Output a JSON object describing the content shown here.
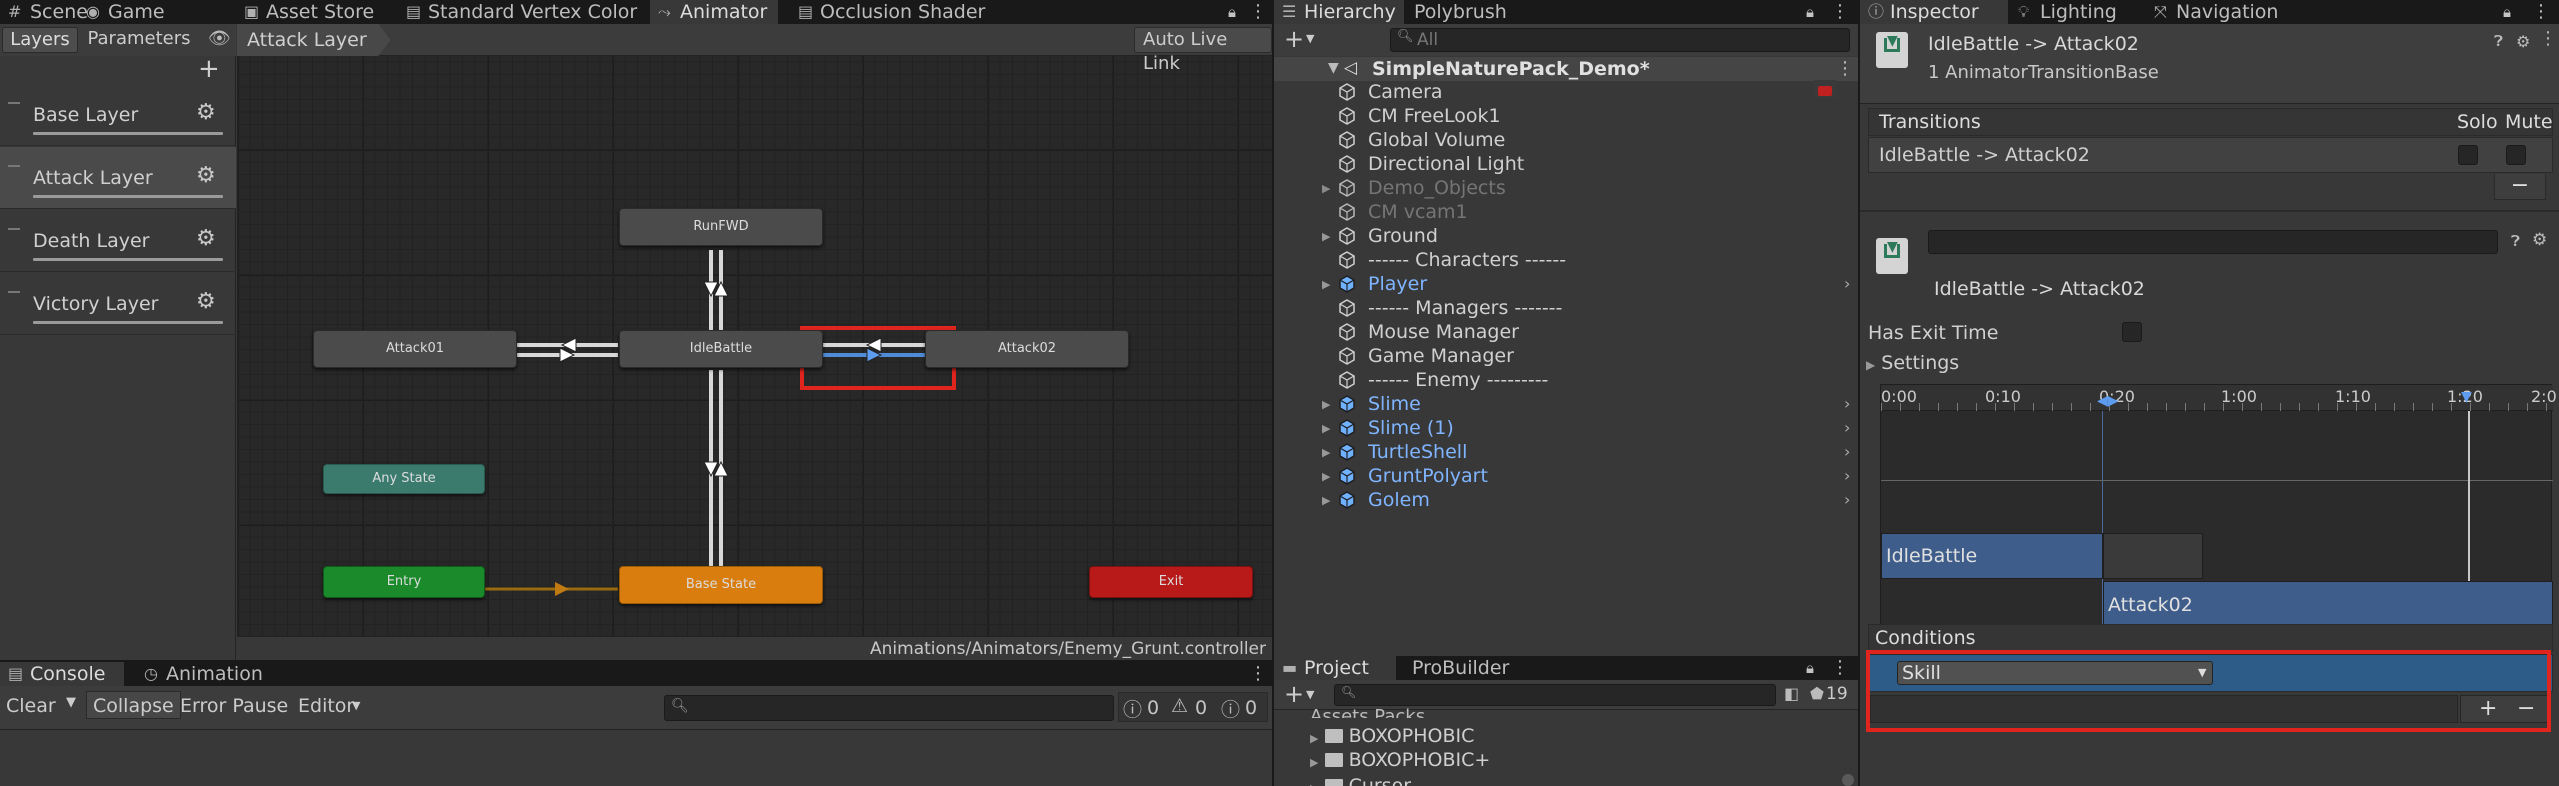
{
  "top_tabs": [
    {
      "label": "Scene",
      "icon": "hash-icon"
    },
    {
      "label": "Game",
      "icon": "game-icon"
    },
    {
      "label": "Asset Store",
      "icon": "bag-icon"
    },
    {
      "label": "Standard Vertex Color",
      "icon": "doc-icon"
    },
    {
      "label": "Animator",
      "icon": "animator-icon"
    },
    {
      "label": "Occlusion Shader",
      "icon": "doc-icon"
    }
  ],
  "animator": {
    "sub_tabs": [
      "Layers",
      "Parameters"
    ],
    "breadcrumb": "Attack Layer",
    "auto_live_link": "Auto Live Link",
    "layers": [
      "Base Layer",
      "Attack Layer",
      "Death Layer",
      "Victory Layer"
    ],
    "nodes": {
      "run": "RunFWD",
      "attack01": "Attack01",
      "idle": "IdleBattle",
      "attack02": "Attack02",
      "any": "Any State",
      "entry": "Entry",
      "base": "Base State",
      "exit": "Exit"
    },
    "path": "Animations/Animators/Enemy_Grunt.controller"
  },
  "console": {
    "tabs": [
      "Console",
      "Animation"
    ],
    "buttons": [
      "Clear",
      "Collapse",
      "Error Pause",
      "Editor"
    ],
    "counts": {
      "info": "0",
      "warn": "0",
      "error": "0"
    }
  },
  "hierarchy": {
    "tabs": [
      "Hierarchy",
      "Polybrush"
    ],
    "search_placeholder": "All",
    "scene": "SimpleNaturePack_Demo*",
    "items": [
      {
        "label": "Camera",
        "type": "plain"
      },
      {
        "label": "CM FreeLook1",
        "type": "plain"
      },
      {
        "label": "Global Volume",
        "type": "plain"
      },
      {
        "label": "Directional Light",
        "type": "plain"
      },
      {
        "label": "Demo_Objects",
        "type": "disabled",
        "fold": true
      },
      {
        "label": "CM vcam1",
        "type": "disabled"
      },
      {
        "label": "Ground",
        "type": "plain",
        "fold": true
      },
      {
        "label": "------ Characters ------",
        "type": "plain"
      },
      {
        "label": "Player",
        "type": "prefab",
        "fold": true,
        "chev": true
      },
      {
        "label": "------ Managers -------",
        "type": "plain"
      },
      {
        "label": "Mouse Manager",
        "type": "plain"
      },
      {
        "label": "Game Manager",
        "type": "plain"
      },
      {
        "label": "------ Enemy ---------",
        "type": "plain"
      },
      {
        "label": "Slime",
        "type": "prefab",
        "fold": true,
        "chev": true
      },
      {
        "label": "Slime (1)",
        "type": "prefab",
        "fold": true,
        "chev": true
      },
      {
        "label": "TurtleShell",
        "type": "prefab",
        "fold": true,
        "chev": true
      },
      {
        "label": "GruntPolyart",
        "type": "prefab",
        "fold": true,
        "chev": true
      },
      {
        "label": "Golem",
        "type": "prefab",
        "fold": true,
        "chev": true
      }
    ]
  },
  "project": {
    "tabs": [
      "Project",
      "ProBuilder"
    ],
    "hidden_count": "19",
    "items": [
      "Assets Packs",
      "BOXOPHOBIC",
      "BOXOPHOBIC+",
      "Cursor"
    ]
  },
  "inspector": {
    "tabs": [
      "Inspector",
      "Lighting",
      "Navigation"
    ],
    "title": "IdleBattle -> Attack02",
    "subtitle": "1 AnimatorTransitionBase",
    "transitions_label": "Transitions",
    "solo": "Solo",
    "mute": "Mute",
    "transition_row": "IdleBattle -> Attack02",
    "minus": "−",
    "name_field": "",
    "transition_title": "IdleBattle -> Attack02",
    "has_exit_time": "Has Exit Time",
    "settings": "Settings",
    "timeline_ticks": [
      "0:00",
      "0:10",
      "0:20",
      "1:00",
      "1:10",
      "1:20",
      "2:0"
    ],
    "clip_from": "IdleBattle",
    "clip_to": "Attack02",
    "conditions": "Conditions",
    "condition_param": "Skill",
    "plus": "+",
    "minus2": "−"
  }
}
